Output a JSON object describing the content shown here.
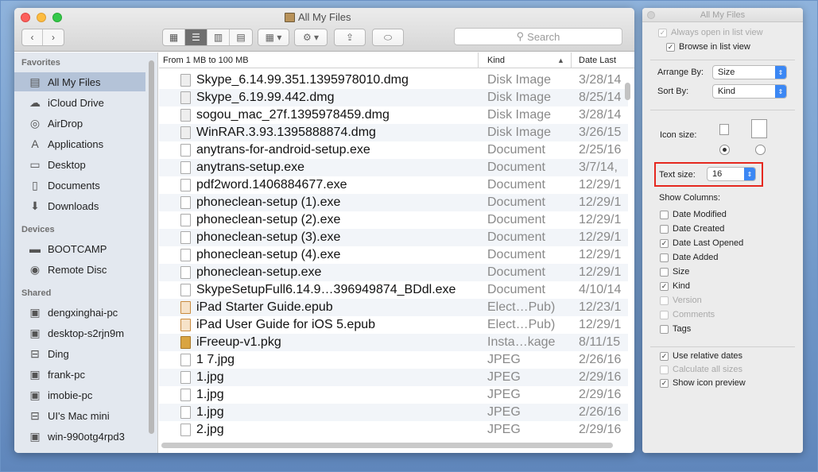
{
  "window": {
    "title": "All My Files",
    "search_placeholder": "Search",
    "colors": {
      "sidebar_selected": "#b4c3d8",
      "highlight_box": "#e5281f",
      "popup_accent": "#3b87f4"
    }
  },
  "sidebar": {
    "sections": [
      {
        "title": "Favorites",
        "items": [
          {
            "label": "All My Files",
            "icon": "all-files-icon",
            "selected": true
          },
          {
            "label": "iCloud Drive",
            "icon": "cloud-icon"
          },
          {
            "label": "AirDrop",
            "icon": "airdrop-icon"
          },
          {
            "label": "Applications",
            "icon": "applications-icon"
          },
          {
            "label": "Desktop",
            "icon": "desktop-icon"
          },
          {
            "label": "Documents",
            "icon": "documents-icon"
          },
          {
            "label": "Downloads",
            "icon": "downloads-icon"
          }
        ]
      },
      {
        "title": "Devices",
        "items": [
          {
            "label": "BOOTCAMP",
            "icon": "drive-icon"
          },
          {
            "label": "Remote Disc",
            "icon": "disc-icon"
          }
        ]
      },
      {
        "title": "Shared",
        "items": [
          {
            "label": "dengxinghai-pc",
            "icon": "computer-icon"
          },
          {
            "label": "desktop-s2rjn9m",
            "icon": "computer-icon"
          },
          {
            "label": "Ding",
            "icon": "network-drive-icon"
          },
          {
            "label": "frank-pc",
            "icon": "computer-icon"
          },
          {
            "label": "imobie-pc",
            "icon": "computer-icon"
          },
          {
            "label": "UI's Mac mini",
            "icon": "mac-mini-icon"
          },
          {
            "label": "win-990otg4rpd3",
            "icon": "computer-icon"
          }
        ]
      }
    ]
  },
  "list": {
    "columns": {
      "name": "From 1 MB to 100 MB",
      "kind": "Kind",
      "date": "Date Last"
    },
    "rows": [
      {
        "name": "Skype_6.14.99.351.1395978010.dmg",
        "kind": "Disk Image",
        "date": "3/28/14",
        "icon": "dmg-icon"
      },
      {
        "name": "Skype_6.19.99.442.dmg",
        "kind": "Disk Image",
        "date": "8/25/14",
        "icon": "dmg-icon"
      },
      {
        "name": "sogou_mac_27f.1395978459.dmg",
        "kind": "Disk Image",
        "date": "3/28/14",
        "icon": "dmg-icon"
      },
      {
        "name": "WinRAR.3.93.1395888874.dmg",
        "kind": "Disk Image",
        "date": "3/26/15",
        "icon": "dmg-icon"
      },
      {
        "name": "anytrans-for-android-setup.exe",
        "kind": "Document",
        "date": "2/25/16",
        "icon": "document-icon"
      },
      {
        "name": "anytrans-setup.exe",
        "kind": "Document",
        "date": "3/7/14,",
        "icon": "document-icon"
      },
      {
        "name": "pdf2word.1406884677.exe",
        "kind": "Document",
        "date": "12/29/1",
        "icon": "document-icon"
      },
      {
        "name": "phoneclean-setup (1).exe",
        "kind": "Document",
        "date": "12/29/1",
        "icon": "document-icon"
      },
      {
        "name": "phoneclean-setup (2).exe",
        "kind": "Document",
        "date": "12/29/1",
        "icon": "document-icon"
      },
      {
        "name": "phoneclean-setup (3).exe",
        "kind": "Document",
        "date": "12/29/1",
        "icon": "document-icon"
      },
      {
        "name": "phoneclean-setup (4).exe",
        "kind": "Document",
        "date": "12/29/1",
        "icon": "document-icon"
      },
      {
        "name": "phoneclean-setup.exe",
        "kind": "Document",
        "date": "12/29/1",
        "icon": "document-icon"
      },
      {
        "name": "SkypeSetupFull6.14.9…396949874_BDdl.exe",
        "kind": "Document",
        "date": "4/10/14",
        "icon": "document-icon"
      },
      {
        "name": "iPad Starter Guide.epub",
        "kind": "Elect…Pub)",
        "date": "12/23/1",
        "icon": "epub-icon"
      },
      {
        "name": "iPad User Guide for iOS 5.epub",
        "kind": "Elect…Pub)",
        "date": "12/29/1",
        "icon": "epub-icon"
      },
      {
        "name": "iFreeup-v1.pkg",
        "kind": "Insta…kage",
        "date": "8/11/15",
        "icon": "package-icon"
      },
      {
        "name": "1 7.jpg",
        "kind": "JPEG",
        "date": "2/26/16",
        "icon": "jpeg-icon"
      },
      {
        "name": "1.jpg",
        "kind": "JPEG",
        "date": "2/29/16",
        "icon": "jpeg-icon"
      },
      {
        "name": "1.jpg",
        "kind": "JPEG",
        "date": "2/29/16",
        "icon": "jpeg-icon"
      },
      {
        "name": "1.jpg",
        "kind": "JPEG",
        "date": "2/26/16",
        "icon": "jpeg-icon"
      },
      {
        "name": "2.jpg",
        "kind": "JPEG",
        "date": "2/29/16",
        "icon": "jpeg-icon"
      }
    ]
  },
  "view_options": {
    "title": "All My Files",
    "always_open_list": {
      "label": "Always open in list view",
      "checked": true,
      "enabled": false
    },
    "browse_list": {
      "label": "Browse in list view",
      "checked": true
    },
    "arrange_by": {
      "label": "Arrange By:",
      "value": "Size"
    },
    "sort_by": {
      "label": "Sort By:",
      "value": "Kind"
    },
    "icon_size": {
      "label": "Icon size:",
      "selected": "small"
    },
    "text_size": {
      "label": "Text size:",
      "value": "16"
    },
    "show_columns": {
      "label": "Show Columns:",
      "items": [
        {
          "label": "Date Modified",
          "checked": false,
          "enabled": true
        },
        {
          "label": "Date Created",
          "checked": false,
          "enabled": true
        },
        {
          "label": "Date Last Opened",
          "checked": true,
          "enabled": true
        },
        {
          "label": "Date Added",
          "checked": false,
          "enabled": true
        },
        {
          "label": "Size",
          "checked": false,
          "enabled": true
        },
        {
          "label": "Kind",
          "checked": true,
          "enabled": true
        },
        {
          "label": "Version",
          "checked": false,
          "enabled": false
        },
        {
          "label": "Comments",
          "checked": false,
          "enabled": false
        },
        {
          "label": "Tags",
          "checked": false,
          "enabled": true
        }
      ]
    },
    "extras": [
      {
        "label": "Use relative dates",
        "checked": true,
        "enabled": true
      },
      {
        "label": "Calculate all sizes",
        "checked": false,
        "enabled": false
      },
      {
        "label": "Show icon preview",
        "checked": true,
        "enabled": true
      }
    ]
  }
}
